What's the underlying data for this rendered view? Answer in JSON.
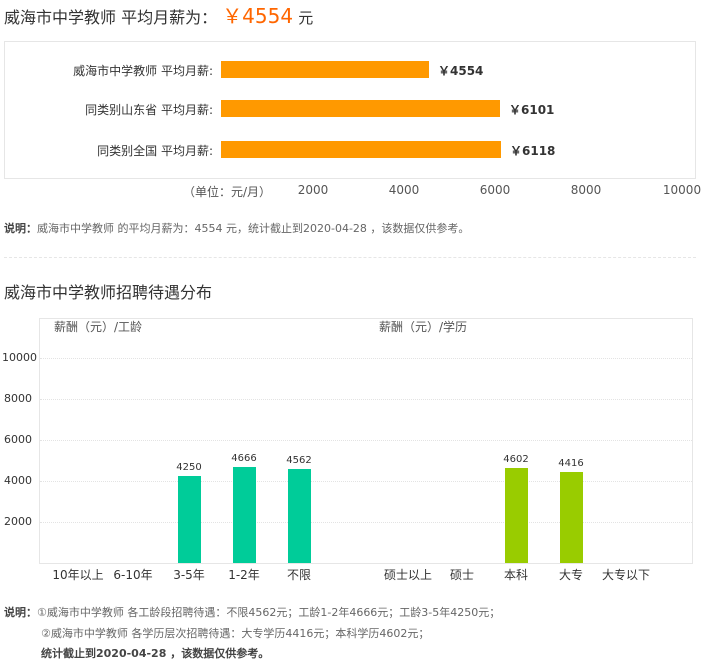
{
  "headline": {
    "prefix": "威海市中学教师 平均月薪为：",
    "amount": "￥4554",
    "unit": "元"
  },
  "colors": {
    "accent": "#ff6600",
    "bar_orange": "#ff9900",
    "bar_teal": "#00cc99",
    "bar_green": "#99cc00"
  },
  "chart_data": [
    {
      "type": "bar",
      "orientation": "horizontal",
      "categories": [
        "威海市中学教师 平均月薪:",
        "同类别山东省 平均月薪:",
        "同类别全国 平均月薪:"
      ],
      "values": [
        4554,
        6101,
        6118
      ],
      "value_labels": [
        "￥4554",
        "￥6101",
        "￥6118"
      ],
      "xlabel": "（单位：元/月）",
      "xticks": [
        "2000",
        "4000",
        "6000",
        "8000",
        "10000"
      ],
      "xlim": [
        0,
        10000
      ],
      "grid": false
    },
    {
      "type": "bar",
      "subtitle_left": "薪酬（元）/工龄",
      "subtitle_right": "薪酬（元）/学历",
      "yticks": [
        "10000",
        "8000",
        "6000",
        "4000",
        "2000"
      ],
      "ylim": [
        0,
        11000
      ],
      "grid": true,
      "groups": [
        {
          "categories": [
            "10年以上",
            "6-10年",
            "3-5年",
            "1-2年",
            "不限"
          ],
          "values": [
            null,
            null,
            4250,
            4666,
            4562
          ],
          "labels": [
            "",
            "",
            "4250",
            "4666",
            "4562"
          ]
        },
        {
          "categories": [
            "硕士以上",
            "硕士",
            "本科",
            "大专",
            "大专以下"
          ],
          "values": [
            null,
            null,
            4602,
            4416,
            null
          ],
          "labels": [
            "",
            "",
            "4602",
            "4416",
            ""
          ]
        }
      ]
    }
  ],
  "note1": {
    "label": "说明：",
    "text": "威海市中学教师 的平均月薪为：4554 元，统计截止到2020-04-28 ，该数据仅供参考。"
  },
  "section_title": "威海市中学教师招聘待遇分布",
  "note2": {
    "label": "说明：",
    "line1": "①威海市中学教师 各工龄段招聘待遇：不限4562元；工龄1-2年4666元；工龄3-5年4250元；",
    "line2": "②威海市中学教师 各学历层次招聘待遇：大专学历4416元；本科学历4602元；",
    "line3": "统计截止到2020-04-28 ，该数据仅供参考。"
  }
}
